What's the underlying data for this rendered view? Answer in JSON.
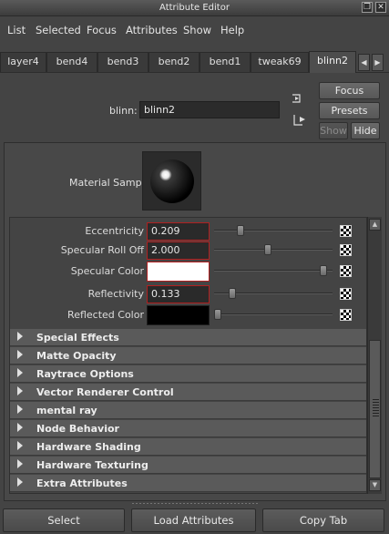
{
  "window": {
    "title": "Attribute Editor",
    "controls": [
      "restore",
      "close"
    ]
  },
  "menubar": [
    "List",
    "Selected",
    "Focus",
    "Attributes",
    "Show",
    "Help"
  ],
  "tabs": [
    "layer4",
    "bend4",
    "bend3",
    "bend2",
    "bend1",
    "tweak69",
    "blinn2"
  ],
  "active_tab": "blinn2",
  "node": {
    "type_label": "blinn:",
    "name": "blinn2"
  },
  "right_buttons": {
    "focus": "Focus",
    "presets": "Presets",
    "show": "Show",
    "hide": "Hide"
  },
  "material_sample_label": "Material Sample",
  "attributes": [
    {
      "label": "Eccentricity",
      "value": "0.209",
      "type": "number",
      "slider": 0.209,
      "highlighted": true
    },
    {
      "label": "Specular Roll Off",
      "value": "2.000",
      "type": "number",
      "slider": 0.45,
      "highlighted": true
    },
    {
      "label": "Specular Color",
      "value": "",
      "type": "color",
      "color": "#ffffff",
      "slider": 0.95,
      "highlighted": true
    },
    {
      "label": "Reflectivity",
      "value": "0.133",
      "type": "number",
      "slider": 0.133,
      "highlighted": true
    },
    {
      "label": "Reflected Color",
      "value": "",
      "type": "color",
      "color": "#000000",
      "slider": 0.0,
      "highlighted": false
    }
  ],
  "sections": [
    "Special Effects",
    "Matte Opacity",
    "Raytrace Options",
    "Vector Renderer Control",
    "mental ray",
    "Node Behavior",
    "Hardware Shading",
    "Hardware Texturing",
    "Extra Attributes"
  ],
  "bottom_buttons": [
    "Select",
    "Load Attributes",
    "Copy Tab"
  ]
}
